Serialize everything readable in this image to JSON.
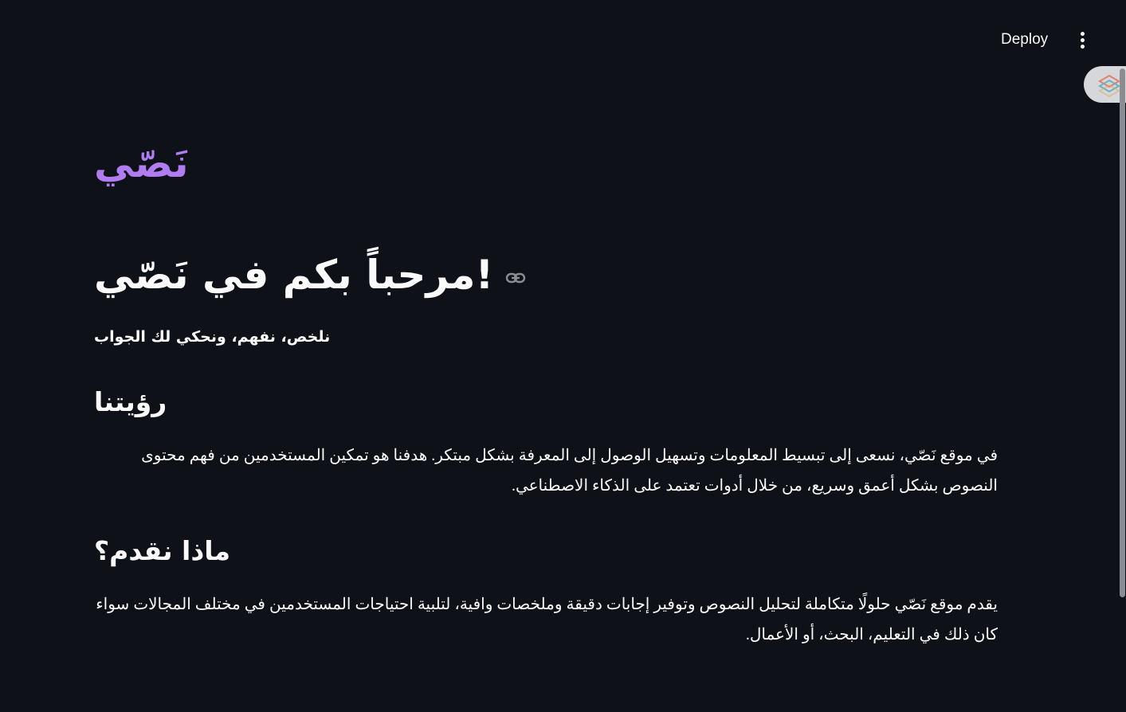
{
  "header": {
    "deploy_label": "Deploy",
    "menu_icon": "vertical-ellipsis-icon",
    "status_icon": "streamlit-logo-icon"
  },
  "main": {
    "logo_text": "نَصّي",
    "title": "!مرحباً بكم في نَصّي",
    "tagline": "نلخص، نفهم، ونحكي لك الجواب",
    "vision": {
      "heading": "رؤيتنا",
      "text": "في موقع نَصّي، نسعى إلى تبسيط المعلومات وتسهيل الوصول إلى المعرفة بشكل مبتكر. هدفنا هو تمكين المستخدمين من فهم محتوى النصوص بشكل أعمق وسريع، من خلال أدوات تعتمد على الذكاء الاصطناعي."
    },
    "offer": {
      "heading": "ماذا نقدم؟",
      "text": "يقدم موقع نَصّي حلولًا متكاملة لتحليل النصوص وتوفير إجابات دقيقة وملخصات وافية، لتلبية احتياجات المستخدمين في مختلف المجالات سواء كان ذلك في التعليم، البحث، أو الأعمال."
    }
  },
  "colors": {
    "background": "#0e1117",
    "text": "#fafafa",
    "accent": "#b07cf0"
  }
}
